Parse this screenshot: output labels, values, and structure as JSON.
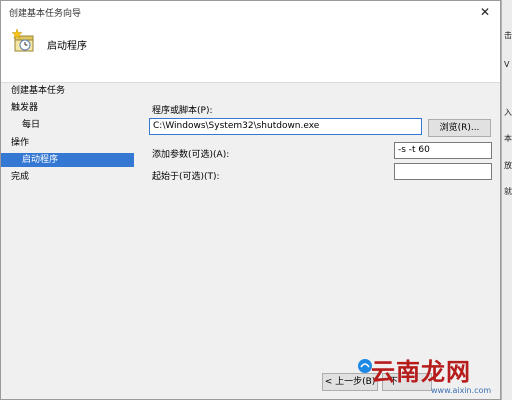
{
  "window": {
    "title": "创建基本任务向导",
    "close_glyph": "✕",
    "header_title": "启动程序"
  },
  "steps": [
    {
      "label": "创建基本任务",
      "level": "top"
    },
    {
      "label": "触发器",
      "level": "top"
    },
    {
      "label": "每日",
      "level": "sub"
    },
    {
      "label": "操作",
      "level": "top"
    },
    {
      "label": "启动程序",
      "level": "sub",
      "active": true
    },
    {
      "label": "完成",
      "level": "top"
    }
  ],
  "form": {
    "program_label": "程序或脚本(P):",
    "program_value": "C:\\Windows\\System32\\shutdown.exe",
    "browse_label": "浏览(R)...",
    "args_label": "添加参数(可选)(A):",
    "args_value": "-s -t 60",
    "start_in_label": "起始于(可选)(T):",
    "start_in_value": ""
  },
  "footer": {
    "back_label": "< 上一步(B)",
    "next_partial": "下"
  },
  "right_strip": {
    "chars": [
      "击",
      "V",
      "入",
      "本",
      "放",
      "就"
    ]
  },
  "watermark": {
    "text": "云南龙网",
    "url": "www.aixin.com"
  },
  "colors": {
    "accent": "#3478d4",
    "watermark_red": "#b71c1c"
  }
}
